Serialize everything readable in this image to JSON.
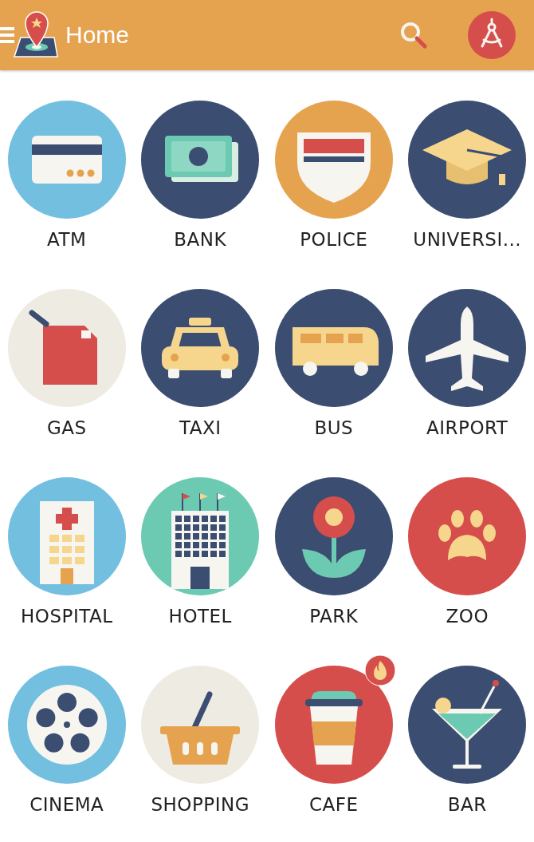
{
  "app_bar": {
    "title": "Home"
  },
  "places": [
    {
      "label": "ATM",
      "kind": "atm",
      "color": "#72bfe0",
      "hot": false
    },
    {
      "label": "BANK",
      "kind": "bank",
      "color": "#3b4d71",
      "hot": false
    },
    {
      "label": "POLICE",
      "kind": "police",
      "color": "#e6a34f",
      "hot": false
    },
    {
      "label": "UNIVERSI...",
      "kind": "university",
      "color": "#3b4d71",
      "hot": false
    },
    {
      "label": "GAS",
      "kind": "gas",
      "color": "#eeebe3",
      "hot": false
    },
    {
      "label": "TAXI",
      "kind": "taxi",
      "color": "#3b4d71",
      "hot": false
    },
    {
      "label": "BUS",
      "kind": "bus",
      "color": "#3b4d71",
      "hot": false
    },
    {
      "label": "AIRPORT",
      "kind": "airport",
      "color": "#3b4d71",
      "hot": false
    },
    {
      "label": "HOSPITAL",
      "kind": "hospital",
      "color": "#72bfe0",
      "hot": false
    },
    {
      "label": "HOTEL",
      "kind": "hotel",
      "color": "#6dcab2",
      "hot": false
    },
    {
      "label": "PARK",
      "kind": "park",
      "color": "#3b4d71",
      "hot": false
    },
    {
      "label": "ZOO",
      "kind": "zoo",
      "color": "#d64e4c",
      "hot": false
    },
    {
      "label": "CINEMA",
      "kind": "cinema",
      "color": "#72bfe0",
      "hot": false
    },
    {
      "label": "SHOPPING",
      "kind": "shopping",
      "color": "#eeebe3",
      "hot": false
    },
    {
      "label": "CAFE",
      "kind": "cafe",
      "color": "#d64e4c",
      "hot": true
    },
    {
      "label": "BAR",
      "kind": "bar",
      "color": "#3b4d71",
      "hot": false
    }
  ]
}
